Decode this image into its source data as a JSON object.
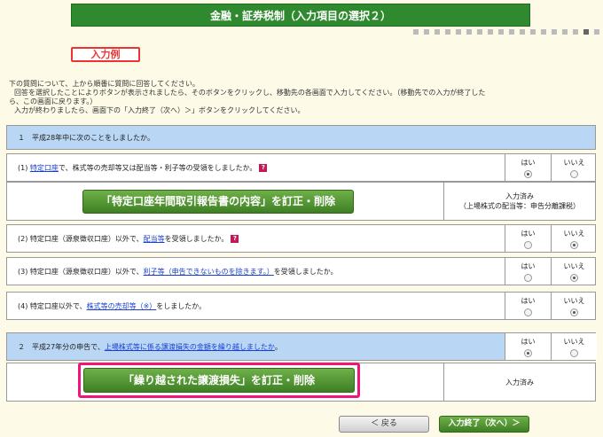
{
  "header": {
    "title": "金融・証券税制（入力項目の選択２）"
  },
  "example_label": "入力例",
  "instructions": [
    "下の質問について、上から順番に質問に回答してください。",
    "回答を選択したことによりボタンが表示されましたら、そのボタンをクリックし、移動先の各画面で入力してください。（移動先での入力が終了した",
    "ら、この画面に戻ります。）",
    "入力が終わりましたら、画面下の「入力終了（次へ）＞」ボタンをクリックしてください。"
  ],
  "section1": {
    "title": "１　平成28年中に次のことをしましたか。"
  },
  "q1": {
    "prefix": "(1)",
    "link": "特定口座",
    "text": "で、株式等の売却等又は配当等・利子等の受領をしましたか。",
    "yes": "はい",
    "no": "いいえ",
    "selected": "yes"
  },
  "q1_action": {
    "button": "「特定口座年間取引報告書の内容」を訂正・削除",
    "status_line1": "入力済み",
    "status_line2": "（上場株式の配当等：申告分離課税）"
  },
  "q2": {
    "prefix": "(2)",
    "text_before": "特定口座（源泉徴収口座）以外で、",
    "link": "配当等",
    "text_after": "を受領しましたか。",
    "yes": "はい",
    "no": "いいえ",
    "selected": "no"
  },
  "q3": {
    "prefix": "(3)",
    "text_before": "特定口座（源泉徴収口座）以外で、",
    "link": "利子等（申告できないものを除きます。）",
    "text_after": "を受領しましたか。",
    "yes": "はい",
    "no": "いいえ",
    "selected": "no"
  },
  "q4": {
    "prefix": "(4)",
    "text_before": "特定口座以外で、",
    "link": "株式等の売却等（※）",
    "text_after": "をしましたか。",
    "yes": "はい",
    "no": "いいえ",
    "selected": "no"
  },
  "section2": {
    "prefix": "２　平成27年分の申告で、",
    "link": "上場株式等に係る譲渡損失の金額を繰り越しましたか",
    "suffix": "。",
    "yes": "はい",
    "no": "いいえ",
    "selected": "yes"
  },
  "s2_action": {
    "button": "「繰り越された譲渡損失」を訂正・削除",
    "status": "入力済み"
  },
  "nav": {
    "back": "＜ 戻る",
    "next": "入力終了（次へ）＞"
  }
}
